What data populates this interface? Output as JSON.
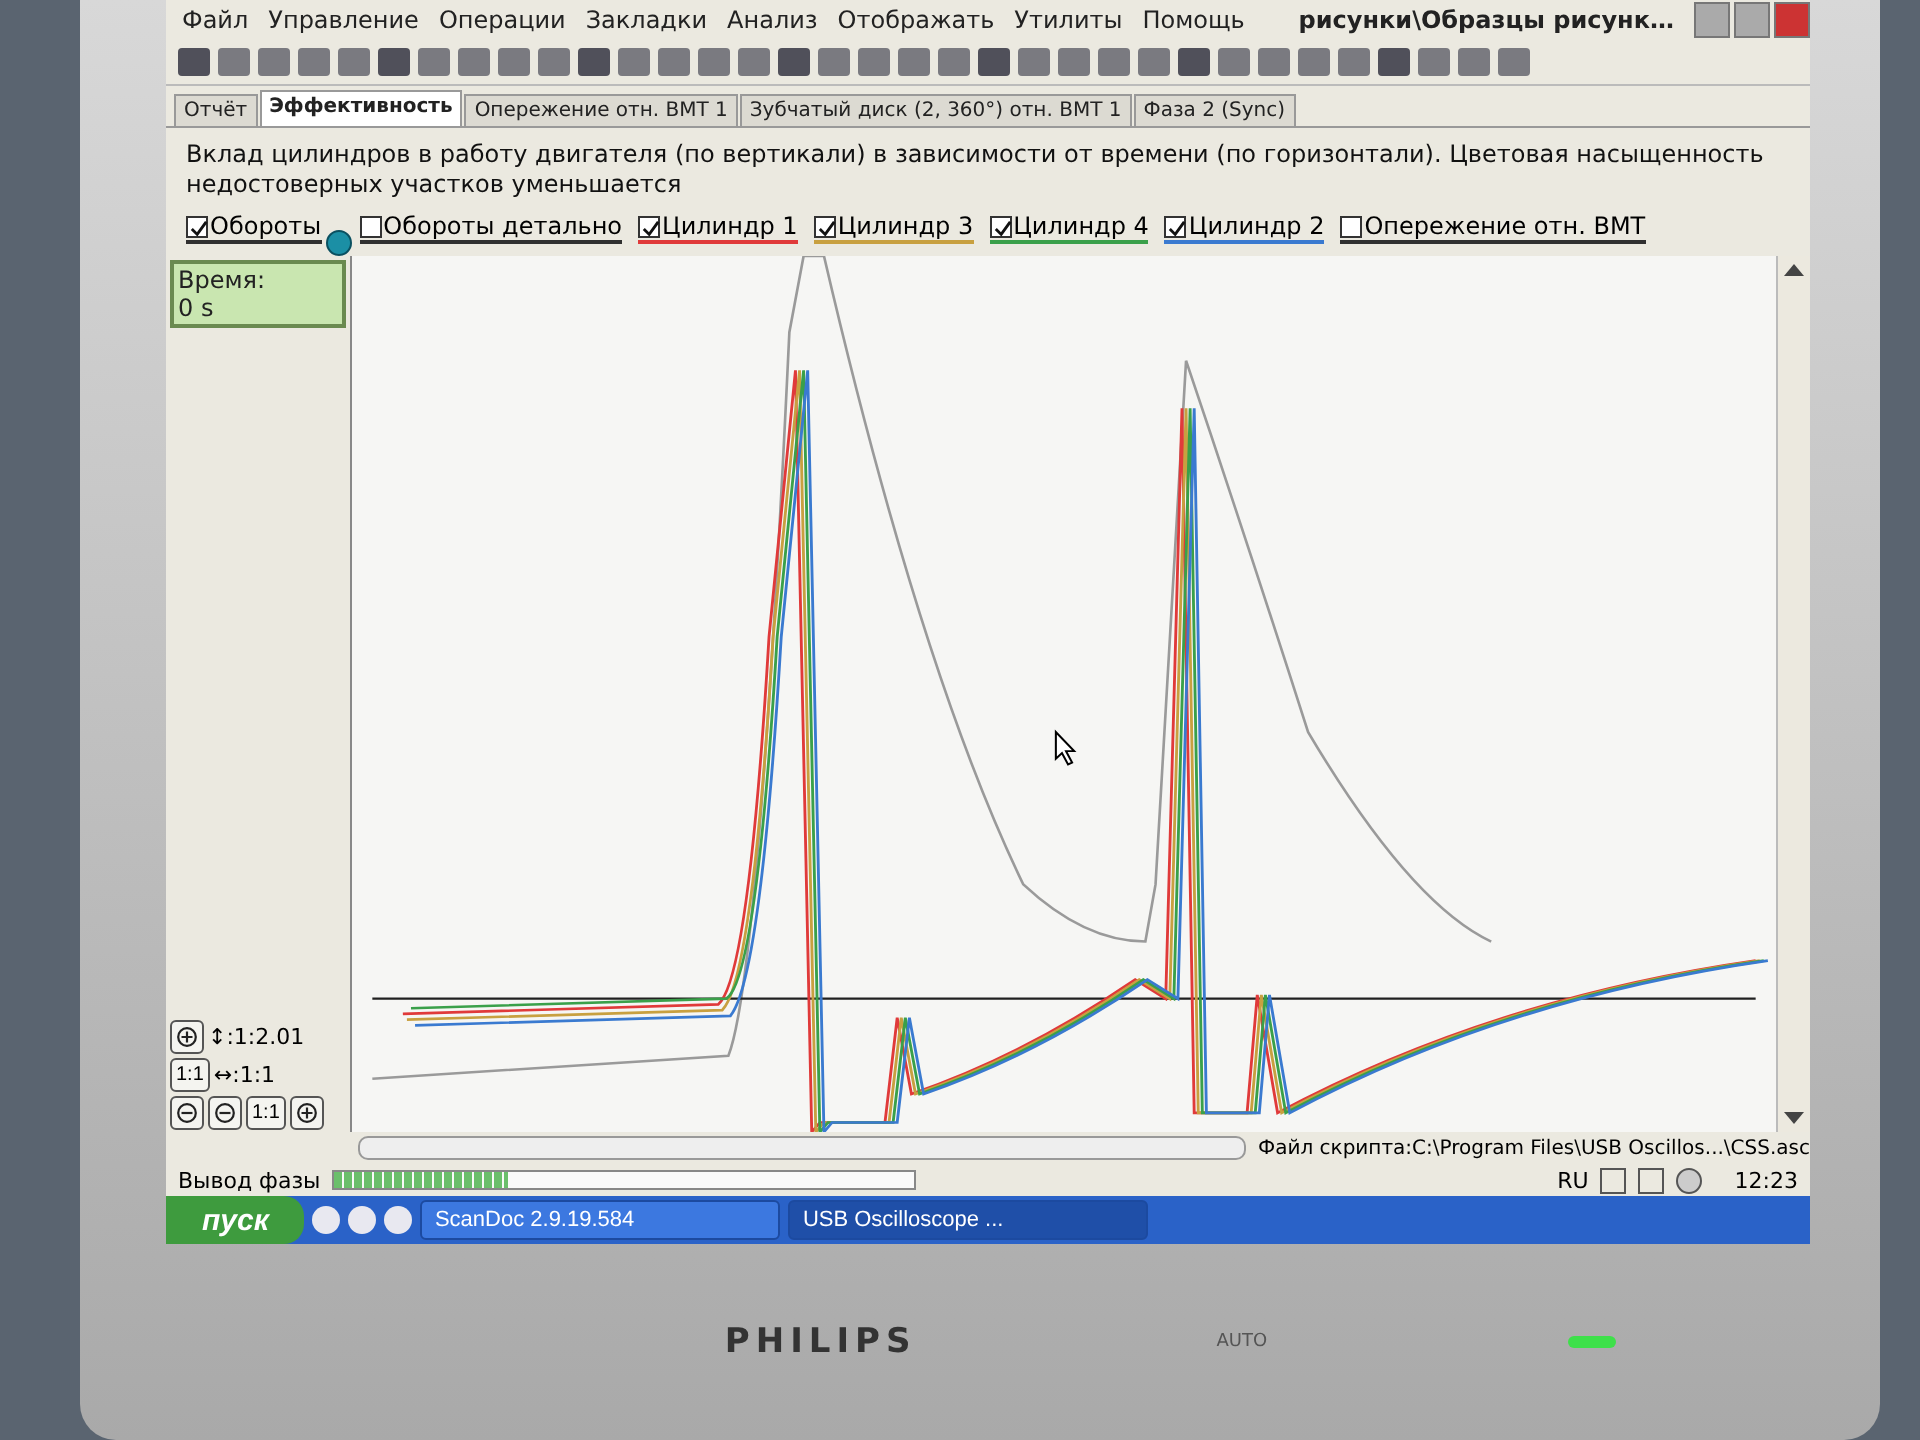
{
  "window": {
    "title": "рисунки\\Образцы рисунк…"
  },
  "menu": [
    "Файл",
    "Управление",
    "Операции",
    "Закладки",
    "Анализ",
    "Отображать",
    "Утилиты",
    "Помощь"
  ],
  "tabs": [
    {
      "label": "Отчёт",
      "selected": false
    },
    {
      "label": "Эффективность",
      "selected": true
    },
    {
      "label": "Опережение отн. ВМТ 1",
      "selected": false
    },
    {
      "label": "Зубчатый диск (2, 360°) отн. ВМТ 1",
      "selected": false
    },
    {
      "label": "Фаза 2 (Sync)",
      "selected": false
    }
  ],
  "description": "Вклад цилиндров в работу двигателя (по вертикали) в зависимости от времени (по горизонтали). Цветовая насыщенность недостоверных участков уменьшается",
  "legend": [
    {
      "label": "Обороты",
      "checked": true,
      "color": "#303030"
    },
    {
      "label": "Обороты детально",
      "checked": false,
      "color": "#303030"
    },
    {
      "label": "Цилиндр 1",
      "checked": true,
      "color": "#e03a3a"
    },
    {
      "label": "Цилиндр 3",
      "checked": true,
      "color": "#c8a040"
    },
    {
      "label": "Цилиндр 4",
      "checked": true,
      "color": "#3aa04a"
    },
    {
      "label": "Цилиндр 2",
      "checked": true,
      "color": "#3a7ad0"
    },
    {
      "label": "Опережение отн. ВМТ",
      "checked": false,
      "color": "#303030"
    }
  ],
  "time_panel": {
    "label": "Время:",
    "value": "0 s"
  },
  "scale": {
    "vertical": "↕:1:2.01",
    "horizontal": "↔:1:1",
    "reset_label": "1:1",
    "bottom_reset_label": "1:1"
  },
  "status_bar": {
    "script_file": "Файл скрипта:C:\\Program Files\\USB Oscillos...\\CSS.asc",
    "phase_label": "Вывод фазы",
    "phase_progress": {
      "level": 0.3
    }
  },
  "taskbar": {
    "start": "пуск",
    "windows": [
      {
        "label": "ScanDoc 2.9.19.584",
        "selected": false
      },
      {
        "label": "USB Oscilloscope ...",
        "selected": true
      }
    ],
    "language": "RU",
    "clock": "12:23"
  },
  "monitor": {
    "brand": "PHILIPS",
    "button_label": "AUTO"
  }
}
